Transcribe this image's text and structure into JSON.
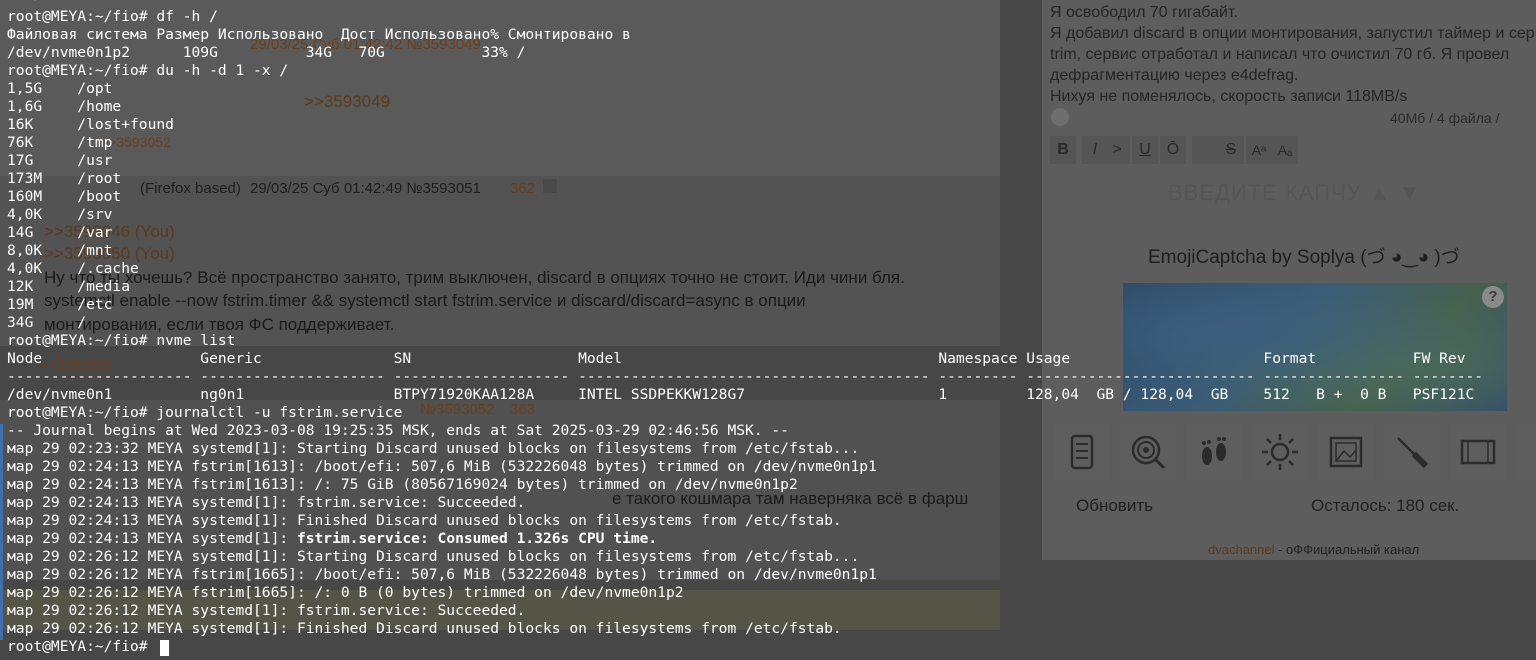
{
  "background": {
    "post": {
      "date_snippet": "29/03/25 Суб 01:42:49 №3593051",
      "count_a": "362",
      "reply_links": [
        ">>3593049",
        ">>3593052",
        ">>3593046 (You)",
        ">>3593050 (You)",
        ">>3593058"
      ],
      "post_lines": [
        "Ну что ты хочешь? Всё пространство занято, трим выключен, discard в опциях точно не стоит. Иди чини бля.",
        "systemctl enable --now fstrim.timer && systemctl start fstrim.service и discard/discard=async в опции",
        "монтирования, если твоя ФС поддерживает."
      ],
      "browser_hint": "(Firefox based)",
      "second_post_num": "№3593052",
      "second_post_count": "363",
      "kashmar_line": "е такого кошмара там наверняка всё в фарш"
    },
    "reply_form": {
      "lines": [
        "Я освободил 70 гигабайт.",
        "Я добавил discard в опции монтирования, запустил таймер и сер",
        "trim, сервис отработал и написал что очистил 70 гб. Я провел",
        "дефрагментацию через e4defrag.",
        "Нихуя не поменялось, скорость записи 118MB/s"
      ],
      "files_info": "40Мб / 4 файла / ",
      "format_buttons": [
        "B",
        "I",
        ">",
        "U",
        "Ō",
        "",
        "S",
        "Aᵃ",
        "Aₐ"
      ],
      "captcha_ghost": "ВВЕДИТЕ КАПЧУ  ▲ ▼",
      "captcha_title": "EmojiCaptcha by Soplya (づ ◕‿◕ )づ",
      "captcha_help": "?",
      "emoji_icons": [
        "scroll-icon",
        "spiral-icon",
        "footprints-icon",
        "sun-icon",
        "frame-icon",
        "screwdriver-icon",
        "film-icon"
      ],
      "refresh_label": "Обновить",
      "timer_label": "Осталось: 180 сек.",
      "channel_link": "dvachannel",
      "channel_suffix": " - оФФициальный канал"
    }
  },
  "terminal": {
    "lines": [
      "   /",
      "root@MEYA:~/fio# df -h /",
      "Файловая система Размер Использовано  Дост Использовано% Смонтировано в",
      "/dev/nvme0n1p2      109G          34G   70G           33% /",
      "root@MEYA:~/fio# du -h -d 1 -x /",
      "1,5G    /opt",
      "1,6G    /home",
      "16K     /lost+found",
      "76K     /tmp",
      "17G     /usr",
      "173M    /root",
      "160M    /boot",
      "4,0K    /srv",
      "14G     /var",
      "8,0K    /mnt",
      "4,0K    /.cache",
      "12K     /media",
      "19M     /etc",
      "34G     /",
      "root@MEYA:~/fio# nvme list",
      "Node                  Generic               SN                   Model                                    Namespace Usage                      Format           FW Rev",
      "--------------------- --------------------- -------------------- ---------------------------------------- --------- -------------------------- ---------------- --------",
      "/dev/nvme0n1          ng0n1                 BTPY71920KAA128A     INTEL SSDPEKKW128G7                      1         128,04  GB / 128,04  GB    512   B +  0 B   PSF121C",
      "root@MEYA:~/fio# journalctl -u fstrim.service",
      "-- Journal begins at Wed 2023-03-08 19:25:35 MSK, ends at Sat 2025-03-29 02:46:56 MSK. --",
      "мар 29 02:23:32 MEYA systemd[1]: Starting Discard unused blocks on filesystems from /etc/fstab...",
      "мар 29 02:24:13 MEYA fstrim[1613]: /boot/efi: 507,6 MiB (532226048 bytes) trimmed on /dev/nvme0n1p1",
      "мар 29 02:24:13 MEYA fstrim[1613]: /: 75 GiB (80567169024 bytes) trimmed on /dev/nvme0n1p2",
      "мар 29 02:24:13 MEYA systemd[1]: fstrim.service: Succeeded.",
      "мар 29 02:24:13 MEYA systemd[1]: Finished Discard unused blocks on filesystems from /etc/fstab.",
      "мар 29 02:24:13 MEYA systemd[1]: fstrim.service: Consumed 1.326s CPU time.",
      "мар 29 02:26:12 MEYA systemd[1]: Starting Discard unused blocks on filesystems from /etc/fstab...",
      "мар 29 02:26:12 MEYA fstrim[1665]: /boot/efi: 507,6 MiB (532226048 bytes) trimmed on /dev/nvme0n1p1",
      "мар 29 02:26:12 MEYA fstrim[1665]: /: 0 B (0 bytes) trimmed on /dev/nvme0n1p2",
      "мар 29 02:26:12 MEYA systemd[1]: fstrim.service: Succeeded.",
      "мар 29 02:26:12 MEYA systemd[1]: Finished Discard unused blocks on filesystems from /etc/fstab.",
      "root@MEYA:~/fio# "
    ],
    "bold_prefix": "мар 29 02:24:13 MEYA systemd[1]: ",
    "bold_part": "fstrim.service: Consumed 1.326s CPU time."
  },
  "colors": {
    "terminal_text": "#ffffff",
    "journal_bar": "#3f6fae",
    "link_color": "#5c3a1f"
  }
}
